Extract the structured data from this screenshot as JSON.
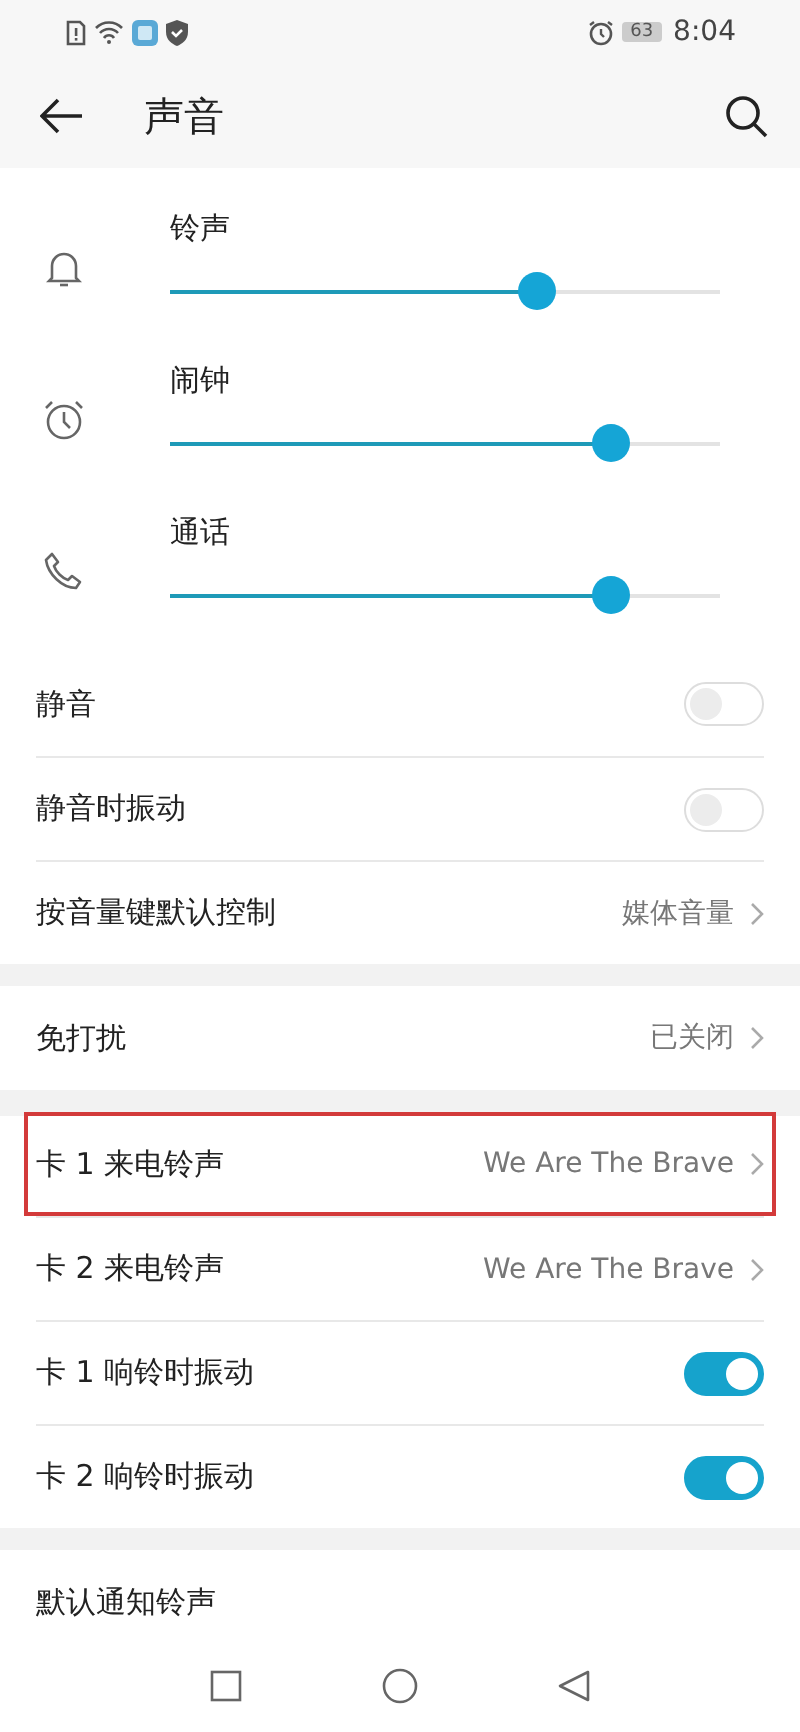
{
  "status_bar": {
    "battery": "63",
    "time": "8:04"
  },
  "header": {
    "title": "声音"
  },
  "volumes": [
    {
      "kind": "bell",
      "label": "铃声",
      "level": 0.665
    },
    {
      "kind": "alarm",
      "label": "闹钟",
      "level": 0.8
    },
    {
      "kind": "phone",
      "label": "通话",
      "level": 0.8
    }
  ],
  "groups": [
    [
      {
        "kind": "toggle",
        "label": "静音",
        "on": false
      },
      {
        "kind": "toggle",
        "label": "静音时振动",
        "on": false
      },
      {
        "kind": "value",
        "label": "按音量键默认控制",
        "value": "媒体音量"
      }
    ],
    [
      {
        "kind": "value",
        "label": "免打扰",
        "value": "已关闭"
      }
    ],
    [
      {
        "kind": "value",
        "label": "卡 1 来电铃声",
        "value": "We Are The Brave",
        "highlighted": true
      },
      {
        "kind": "value",
        "label": "卡 2 来电铃声",
        "value": "We Are The Brave",
        "highlighted": false
      },
      {
        "kind": "toggle",
        "label": "卡 1 响铃时振动",
        "on": true
      },
      {
        "kind": "toggle",
        "label": "卡 2 响铃时振动",
        "on": true
      }
    ],
    [
      {
        "kind": "plain",
        "label": "默认通知铃声"
      }
    ]
  ]
}
